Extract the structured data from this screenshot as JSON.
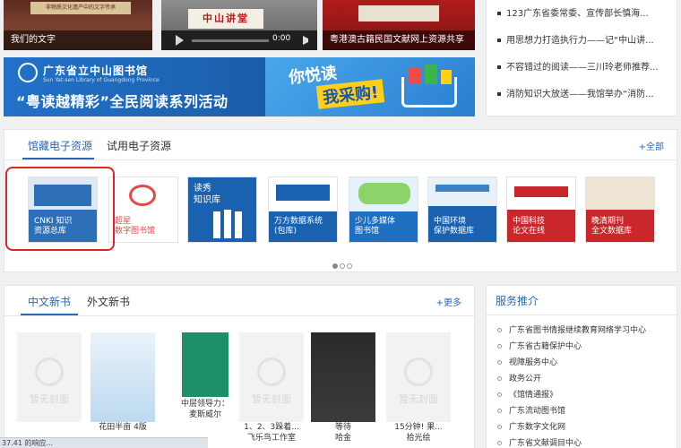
{
  "top_strip": {
    "items": [
      {
        "caption": "我们的文字",
        "banner_text": "非物质文化遗产中的文字传承"
      },
      {
        "sign_text": "中山讲堂",
        "time": "0:00"
      },
      {
        "caption": "粤港澳古籍民国文献网上资源共享"
      }
    ]
  },
  "news": {
    "items": [
      "123广东省委常委、宣传部长慎海...",
      "用思想力打造执行力——记“中山讲...",
      "不容错过的阅读——三川玲老师推荐...",
      "消防知识大放送——我馆举办“消防..."
    ]
  },
  "banner": {
    "org_cn": "广东省立中山图书馆",
    "org_en": "Sun Yat-sen Library of Guangdong Province",
    "slogan": "“粤读越精彩”全民阅读系列活动",
    "cta_line1": "你悦读",
    "cta_line2": "我采购!"
  },
  "resources": {
    "tabs": [
      "馆藏电子资源",
      "试用电子资源"
    ],
    "more_label": "+全部",
    "cards": [
      {
        "label": "CNKI 知识\n资源总库",
        "color": "#2d70b8"
      },
      {
        "label": "超星\n数字图书馆",
        "color": "#e44848"
      },
      {
        "label": "读秀\n知识库",
        "color": "#1a62b0"
      },
      {
        "label": "万方数据系统\n(包库)",
        "color": "#1a62b0"
      },
      {
        "label": "少儿多媒体\n图书馆",
        "color": "#1f6fc1"
      },
      {
        "label": "中国环境\n保护数据库",
        "color": "#1a62b0"
      },
      {
        "label": "中国科技\n论文在线",
        "color": "#c9272c"
      },
      {
        "label": "晚清期刊\n全文数据库",
        "color": "#c9272c"
      }
    ]
  },
  "new_books": {
    "tabs": [
      "中文新书",
      "外文新书"
    ],
    "more_label": "+更多",
    "no_cover_text": "暂无封面",
    "items": [
      {
        "title": "",
        "author": ""
      },
      {
        "title": "花田半亩 4版",
        "author": ""
      },
      {
        "title": "中层领导力：",
        "author": "麦斯威尔"
      },
      {
        "title": "1、2、3跺着...",
        "author": "飞乐鸟工作室"
      },
      {
        "title": "等待",
        "author": "哈金"
      },
      {
        "title": "15分钟! 果...",
        "author": "拾光绘"
      }
    ]
  },
  "service": {
    "title": "服务推介",
    "items": [
      "广东省图书情报继续教育网络学习中心",
      "广东省古籍保护中心",
      "视障服务中心",
      "政务公开",
      "《馆情通报》",
      "广东流动图书馆",
      "广东数字文化网",
      "广东省文献调目中心"
    ]
  },
  "status_bar": "37.41 的响应..."
}
